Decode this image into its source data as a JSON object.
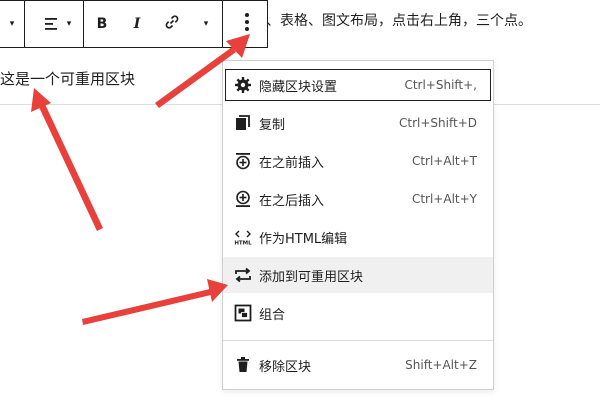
{
  "toolbar": {
    "align_icon": "align-left-icon",
    "bold_label": "B",
    "italic_label": "I",
    "link_icon": "link-icon",
    "caret": "▾",
    "more_icon": "more-vertical-icon"
  },
  "top_text": "、表格、图文布局，点击右上角，三个点。",
  "block_text": "这是一个可重用区块",
  "menu": {
    "items": [
      {
        "icon": "gear-icon",
        "label": "隐藏区块设置",
        "shortcut": "Ctrl+Shift+,"
      },
      {
        "icon": "copy-icon",
        "label": "复制",
        "shortcut": "Ctrl+Shift+D"
      },
      {
        "icon": "insert-before-icon",
        "label": "在之前插入",
        "shortcut": "Ctrl+Alt+T"
      },
      {
        "icon": "insert-after-icon",
        "label": "在之后插入",
        "shortcut": "Ctrl+Alt+Y"
      },
      {
        "icon": "html-icon",
        "label": "作为HTML编辑",
        "shortcut": ""
      },
      {
        "icon": "reusable-icon",
        "label": "添加到可重用区块",
        "shortcut": ""
      },
      {
        "icon": "group-icon",
        "label": "组合",
        "shortcut": ""
      },
      {
        "icon": "trash-icon",
        "label": "移除区块",
        "shortcut": "Shift+Alt+Z"
      }
    ]
  },
  "colors": {
    "arrow": "#e8403a",
    "text": "#1e1e1e",
    "hover_bg": "#f0f0f0"
  }
}
